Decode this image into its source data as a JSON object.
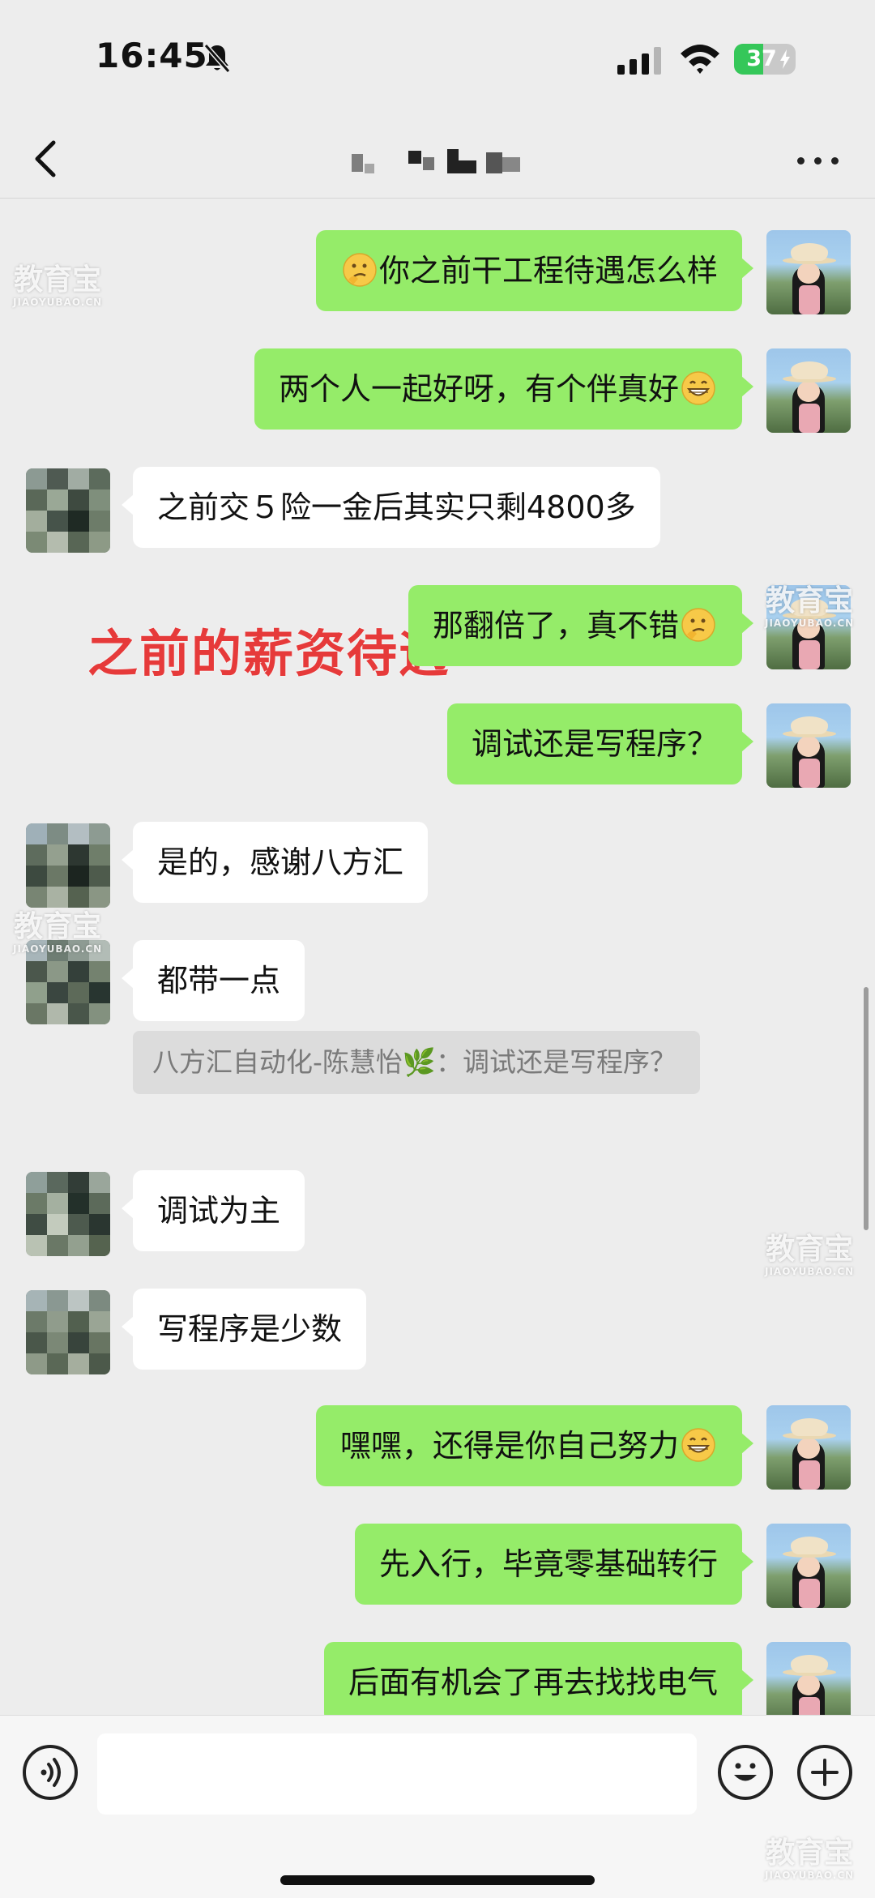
{
  "status_bar": {
    "time": "16:45",
    "battery": "37"
  },
  "header": {
    "title": ""
  },
  "annotation": "之前的薪资待遇",
  "watermark": {
    "main": "教育宝",
    "sub": "JIAOYUBAO.CN"
  },
  "messages": [
    {
      "side": "out",
      "text": "你之前干工程待遇怎么样",
      "emoji": "thinking-face"
    },
    {
      "side": "out",
      "text": "两个人一起好呀，有个伴真好",
      "emoji": "grinning-face"
    },
    {
      "side": "in",
      "text": "之前交５险一金后其实只剩4800多"
    },
    {
      "side": "out",
      "text": "那翻倍了，真不错",
      "emoji": "thinking-face"
    },
    {
      "side": "out",
      "text": "调试还是写程序？"
    },
    {
      "side": "in",
      "text": "是的，感谢八方汇"
    },
    {
      "side": "in",
      "text": "都带一点",
      "quote": "八方汇自动化-陈慧怡🌿：调试还是写程序？"
    },
    {
      "side": "in",
      "text": "调试为主"
    },
    {
      "side": "in",
      "text": "写程序是少数"
    },
    {
      "side": "out",
      "text": "嘿嘿，还得是你自己努力",
      "emoji": "grinning-face"
    },
    {
      "side": "out",
      "text": "先入行，毕竟零基础转行"
    },
    {
      "side": "out",
      "text": "后面有机会了再去找找电气"
    }
  ],
  "input": {
    "placeholder": ""
  },
  "colors": {
    "outgoing_bubble": "#95ec69",
    "incoming_bubble": "#ffffff",
    "background": "#ededed",
    "annotation": "#e63a3a",
    "battery": "#35c759"
  }
}
